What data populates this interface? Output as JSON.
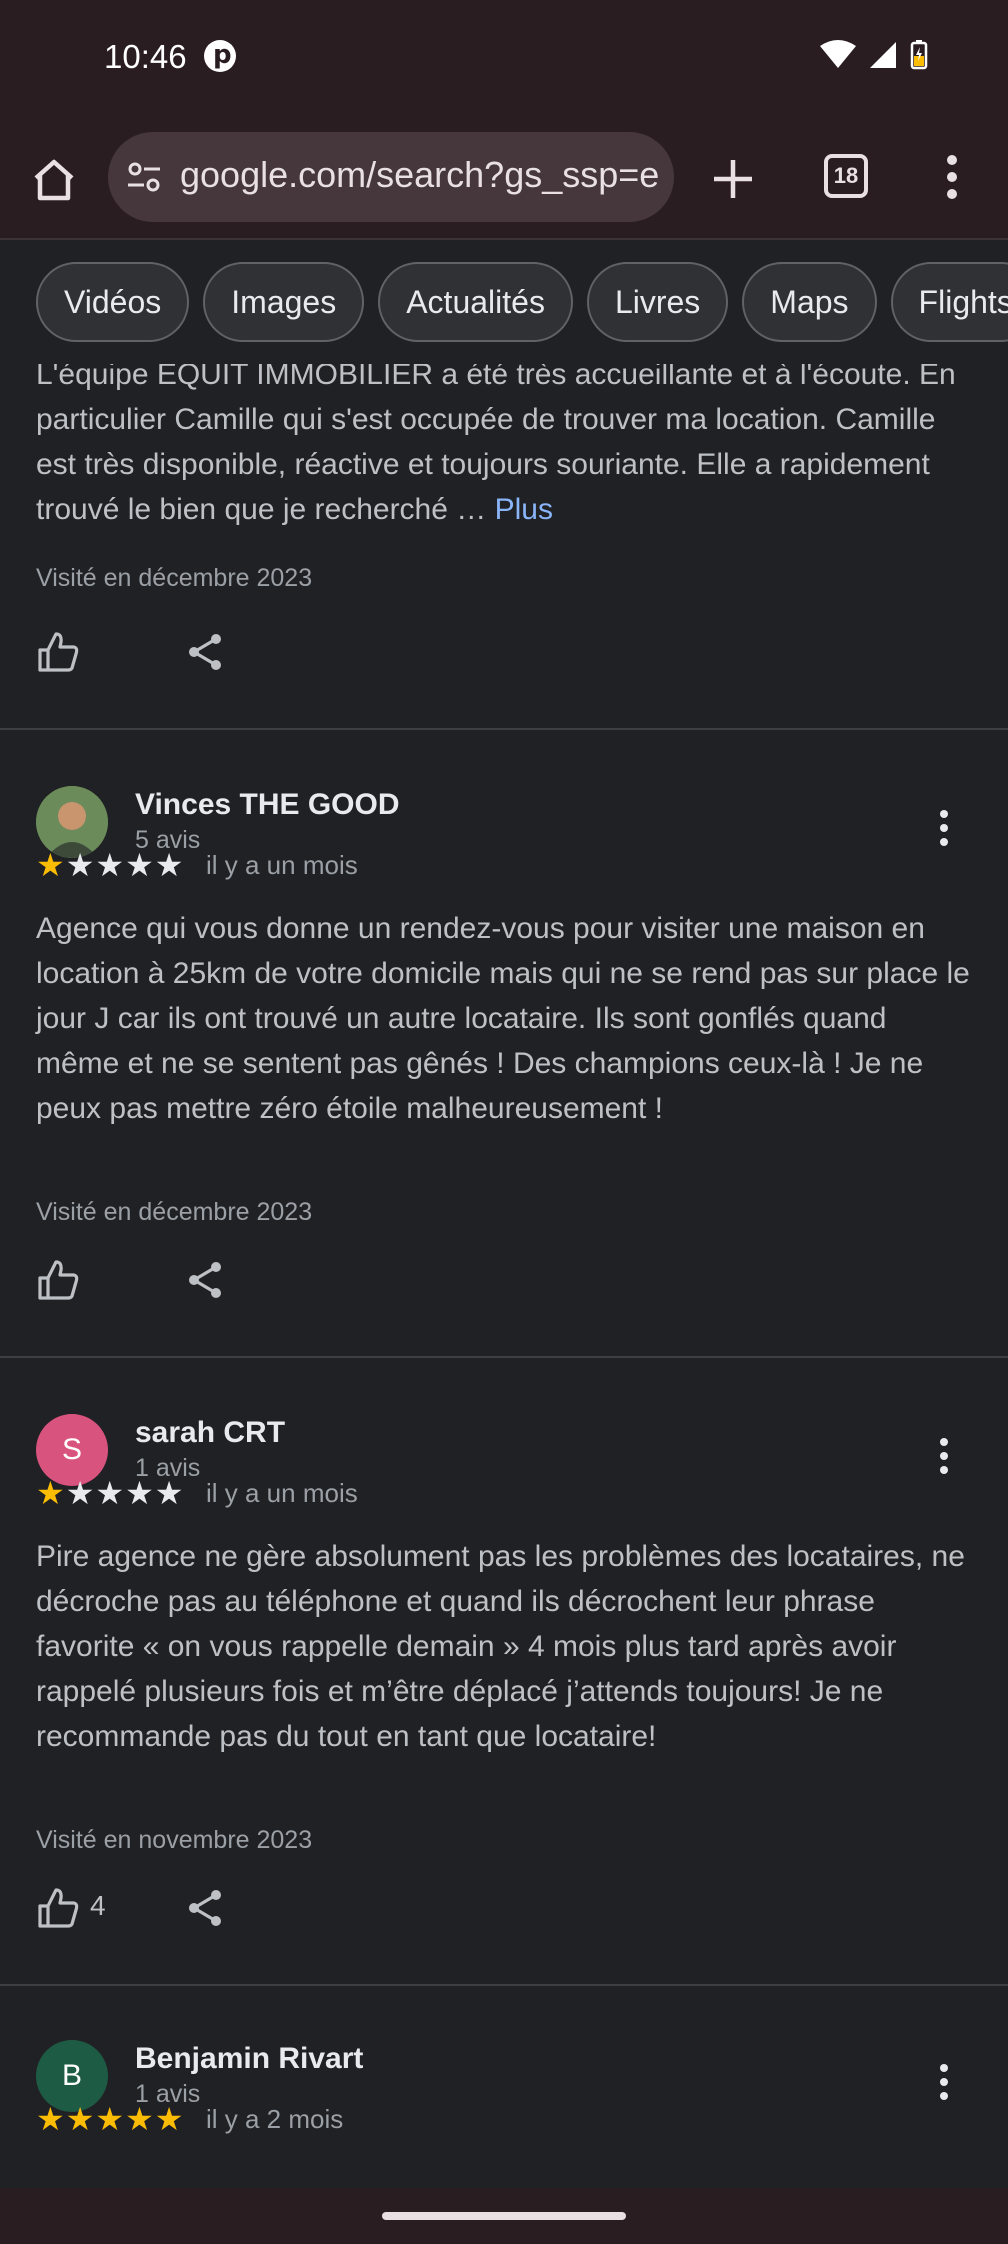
{
  "status": {
    "time": "10:46"
  },
  "browser": {
    "url": "google.com/search?gs_ssp=e",
    "tab_count": "18"
  },
  "chips": [
    "Vidéos",
    "Images",
    "Actualités",
    "Livres",
    "Maps",
    "Flights"
  ],
  "partial_review": {
    "text": "L'équipe EQUIT IMMOBILIER a été très accueillante et à l'écoute. En particulier Camille qui s'est occupée de trouver ma location. Camille est très disponible, réactive et toujours souriante. Elle a rapidement trouvé le bien que je recherché …",
    "more": "Plus",
    "visited": "Visité en décembre 2023"
  },
  "reviews": [
    {
      "author": "Vinces THE GOOD",
      "count": "5 avis",
      "rating": 1,
      "when": "il y a un mois",
      "text": "Agence qui vous donne un rendez-vous pour visiter une maison en location à 25km de votre domicile mais qui ne se rend pas sur place le jour J car ils ont trouvé un autre locataire. Ils sont gonflés quand même et ne se sentent pas gênés ! Des champions ceux-là ! Je ne peux pas mettre zéro étoile malheureusement !",
      "visited": "Visité en décembre 2023",
      "likes": ""
    },
    {
      "author": "sarah CRT",
      "count": "1 avis",
      "rating": 1,
      "when": "il y a un mois",
      "avatar_letter": "S",
      "avatar_color": "#d9537f",
      "text": "Pire agence ne gère absolument pas les problèmes des locataires, ne décroche pas au téléphone et quand ils décrochent leur phrase favorite « on vous rappelle demain » 4 mois plus tard après avoir rappelé plusieurs fois et m’être déplacé j’attends toujours! Je ne recommande pas du tout en tant que locataire!",
      "visited": "Visité en novembre 2023",
      "likes": "4"
    },
    {
      "author": "Benjamin Rivart",
      "count": "1 avis",
      "rating": 5,
      "when": "il y a 2 mois",
      "avatar_letter": "B",
      "avatar_color": "#1e5b45"
    }
  ],
  "colors": {
    "star": "#fbbc04",
    "link": "#8ab4f8",
    "background": "#202124",
    "chrome": "#2a1d21"
  }
}
